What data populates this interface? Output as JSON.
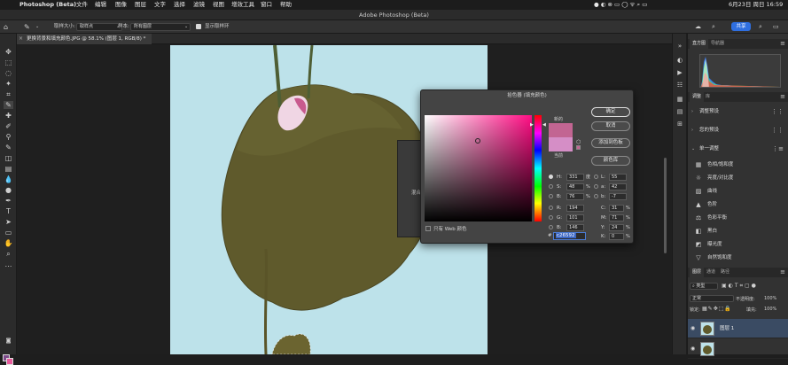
{
  "menubar": {
    "apple": "",
    "app": "Photoshop (Beta)",
    "items": [
      "文件",
      "编辑",
      "图像",
      "图层",
      "文字",
      "选择",
      "滤镜",
      "视图",
      "增效工具",
      "窗口",
      "帮助"
    ],
    "clock": "6月23日 周日  16:59"
  },
  "window": {
    "title": "Adobe Photoshop (Beta)"
  },
  "options": {
    "sample_size_label": "取样大小:",
    "sample_size_value": "取样点",
    "sample_label": "样本:",
    "sample_value": "所有图层",
    "show_ring_label": "显示取样环",
    "share_label": "共享"
  },
  "document": {
    "tab_title": "更换背景和填充颜色.JPG @ 58.1% (图层 1, RGB/8) *"
  },
  "bg_dialog": {
    "label": "混合"
  },
  "picker": {
    "title": "拾色器 (填充颜色)",
    "new_label": "新的",
    "current_label": "当前",
    "ok": "确定",
    "cancel": "取消",
    "add_swatch": "添加到色板",
    "color_libraries": "颜色库",
    "web_only": "只有 Web 颜色",
    "hue_pos": 0.92,
    "fields_left": [
      {
        "label": "H:",
        "value": "331",
        "unit": "度",
        "selected": true
      },
      {
        "label": "S:",
        "value": "48",
        "unit": "%",
        "selected": false
      },
      {
        "label": "B:",
        "value": "76",
        "unit": "%",
        "selected": false
      },
      {
        "label": "R:",
        "value": "194",
        "unit": "",
        "selected": false
      },
      {
        "label": "G:",
        "value": "101",
        "unit": "",
        "selected": false
      },
      {
        "label": "B:",
        "value": "146",
        "unit": "",
        "selected": false
      }
    ],
    "fields_right": [
      {
        "label": "L:",
        "value": "55",
        "unit": ""
      },
      {
        "label": "a:",
        "value": "42",
        "unit": ""
      },
      {
        "label": "b:",
        "value": "-7",
        "unit": ""
      },
      {
        "label": "C:",
        "value": "31",
        "unit": "%"
      },
      {
        "label": "M:",
        "value": "71",
        "unit": "%"
      },
      {
        "label": "Y:",
        "value": "24",
        "unit": "%"
      },
      {
        "label": "K:",
        "value": "0",
        "unit": "%"
      }
    ],
    "hash": "#",
    "hex": "c26592",
    "new_color": "#c26592",
    "current_color": "#d58ec6"
  },
  "panels": {
    "histogram_tabs": [
      "直方图",
      "导航器"
    ],
    "adjust_tabs": [
      "调整",
      "库"
    ],
    "adjust_presets": "调整预设",
    "your_presets": "您的预设",
    "single_adjust": "单一调整",
    "adjust_items": [
      {
        "icon": "hue-sat-icon",
        "label": "色相/饱和度"
      },
      {
        "icon": "brightness-icon",
        "label": "亮度/对比度"
      },
      {
        "icon": "curves-icon",
        "label": "曲线"
      },
      {
        "icon": "levels-icon",
        "label": "色阶"
      },
      {
        "icon": "color-balance-icon",
        "label": "色彩平衡"
      },
      {
        "icon": "black-white-icon",
        "label": "黑白"
      },
      {
        "icon": "exposure-icon",
        "label": "曝光度"
      },
      {
        "icon": "vibrance-icon",
        "label": "自然饱和度"
      }
    ],
    "layer_tabs": [
      "图层",
      "通道",
      "路径"
    ],
    "kind_label": "类型",
    "blend_mode": "正常",
    "opacity_label": "不透明度:",
    "opacity_value": "100%",
    "lock_label": "锁定:",
    "fill_label": "填充:",
    "fill_value": "100%",
    "layers": [
      {
        "name": "图层 1",
        "selected": true
      },
      {
        "name": "",
        "selected": false
      }
    ]
  },
  "colors": {
    "foreground": "#7d4a8a",
    "background": "#e85b9c",
    "accent": "#2f6fe0"
  }
}
